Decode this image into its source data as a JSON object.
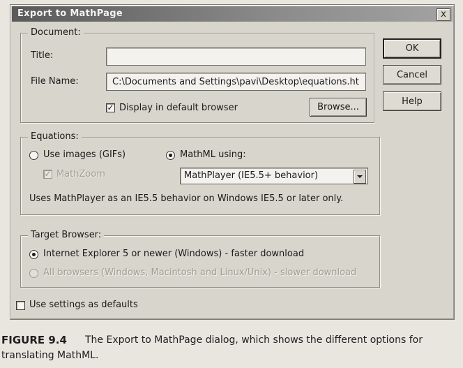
{
  "dialog": {
    "title": "Export to MathPage",
    "close_label": "x"
  },
  "document": {
    "legend": "Document:",
    "title_label": "Title:",
    "title_value": "",
    "file_label": "File Name:",
    "file_value": "C:\\Documents and Settings\\pavi\\Desktop\\equations.htm",
    "display_checkbox_label": "Display in default browser",
    "display_checked": true,
    "browse_label": "Browse..."
  },
  "buttons": {
    "ok": "OK",
    "cancel": "Cancel",
    "help": "Help"
  },
  "equations": {
    "legend": "Equations:",
    "images_label": "Use images (GIFs)",
    "mathzoom_label": "MathZoom",
    "mathml_label": "MathML using:",
    "mathml_select_value": "MathPlayer (IE5.5+ behavior)",
    "description": "Uses MathPlayer as an IE5.5 behavior on Windows IE5.5 or later only."
  },
  "target": {
    "legend": "Target Browser:",
    "ie_label": "Internet Explorer 5 or newer (Windows) - faster download",
    "all_label": "All browsers (Windows, Macintosh and Linux/Unix) - slower download"
  },
  "defaults": {
    "label": "Use settings as defaults",
    "checked": false
  },
  "caption": {
    "figure_number": "FIGURE 9.4",
    "line1": "The Export to MathPage dialog, which shows the different options for",
    "line2": "translating MathML."
  }
}
